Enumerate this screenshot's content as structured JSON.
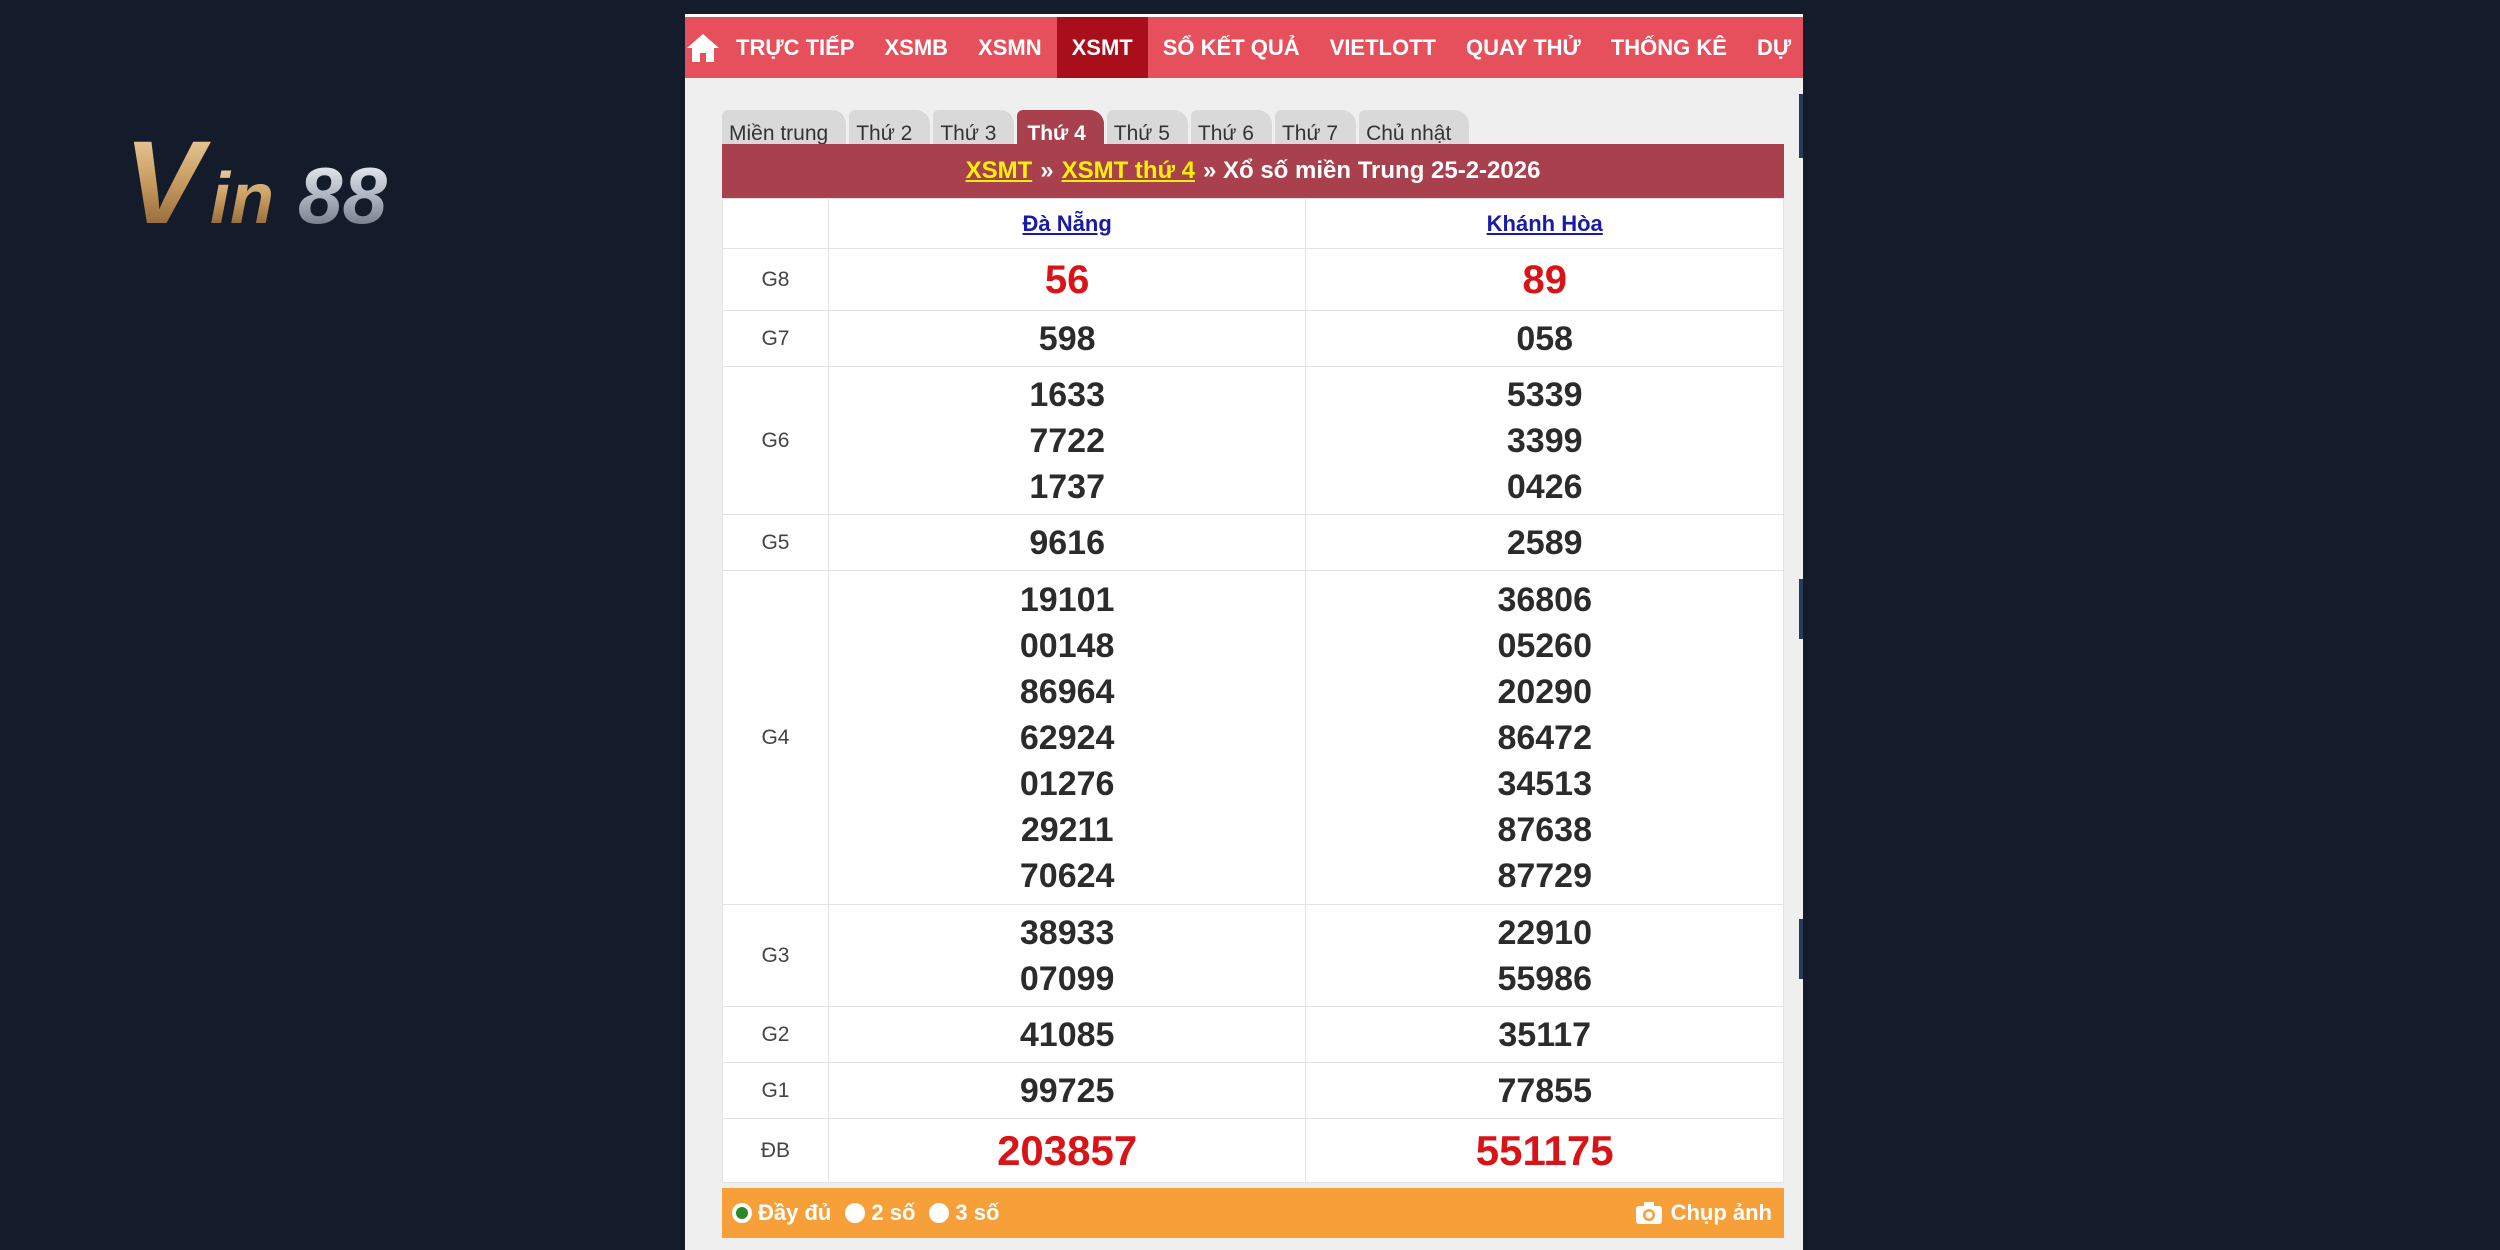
{
  "logo": {
    "text": "Vin88"
  },
  "nav": {
    "items": [
      {
        "label": "TRỰC TIẾP",
        "active": false
      },
      {
        "label": "XSMB",
        "active": false
      },
      {
        "label": "XSMN",
        "active": false
      },
      {
        "label": "XSMT",
        "active": true
      },
      {
        "label": "SỔ KẾT QUẢ",
        "active": false
      },
      {
        "label": "VIETLOTT",
        "active": false
      },
      {
        "label": "QUAY THỬ",
        "active": false
      },
      {
        "label": "THỐNG KÊ",
        "active": false
      },
      {
        "label": "DỰ",
        "active": false
      }
    ]
  },
  "tabs": [
    {
      "label": "Miền trung",
      "active": false
    },
    {
      "label": "Thứ 2",
      "active": false
    },
    {
      "label": "Thứ 3",
      "active": false
    },
    {
      "label": "Thứ 4",
      "active": true
    },
    {
      "label": "Thứ 5",
      "active": false
    },
    {
      "label": "Thứ 6",
      "active": false
    },
    {
      "label": "Thứ 7",
      "active": false
    },
    {
      "label": "Chủ nhật",
      "active": false
    }
  ],
  "title": {
    "link1": "XSMT",
    "sep": "»",
    "link2": "XSMT thứ 4",
    "rest": "» Xổ số miền Trung 25-2-2026"
  },
  "provinces": [
    "Đà Nẵng",
    "Khánh Hòa"
  ],
  "prizes": [
    {
      "label": "G8",
      "style": "red",
      "values": [
        [
          "56"
        ],
        [
          "89"
        ]
      ]
    },
    {
      "label": "G7",
      "style": "",
      "values": [
        [
          "598"
        ],
        [
          "058"
        ]
      ]
    },
    {
      "label": "G6",
      "style": "",
      "values": [
        [
          "1633",
          "7722",
          "1737"
        ],
        [
          "5339",
          "3399",
          "0426"
        ]
      ]
    },
    {
      "label": "G5",
      "style": "",
      "values": [
        [
          "9616"
        ],
        [
          "2589"
        ]
      ]
    },
    {
      "label": "G4",
      "style": "",
      "values": [
        [
          "19101",
          "00148",
          "86964",
          "62924",
          "01276",
          "29211",
          "70624"
        ],
        [
          "36806",
          "05260",
          "20290",
          "86472",
          "34513",
          "87638",
          "87729"
        ]
      ]
    },
    {
      "label": "G3",
      "style": "",
      "values": [
        [
          "38933",
          "07099"
        ],
        [
          "22910",
          "55986"
        ]
      ]
    },
    {
      "label": "G2",
      "style": "",
      "values": [
        [
          "41085"
        ],
        [
          "35117"
        ]
      ]
    },
    {
      "label": "G1",
      "style": "",
      "values": [
        [
          "99725"
        ],
        [
          "77855"
        ]
      ]
    },
    {
      "label": "ĐB",
      "style": "special",
      "values": [
        [
          "203857"
        ],
        [
          "551175"
        ]
      ]
    }
  ],
  "options": {
    "items": [
      {
        "label": "Đầy đủ",
        "checked": true
      },
      {
        "label": "2 số",
        "checked": false
      },
      {
        "label": "3 số",
        "checked": false
      }
    ],
    "capture_label": "Chụp ảnh"
  },
  "colors": {
    "nav_bg": "#e5505c",
    "nav_active": "#a80f1a",
    "title_bg": "#a8404e",
    "link_yellow": "#fff200",
    "prize_red": "#d81418",
    "options_bg": "#f7a03a"
  },
  "icons": {
    "home": "home-icon",
    "camera": "camera-icon"
  }
}
